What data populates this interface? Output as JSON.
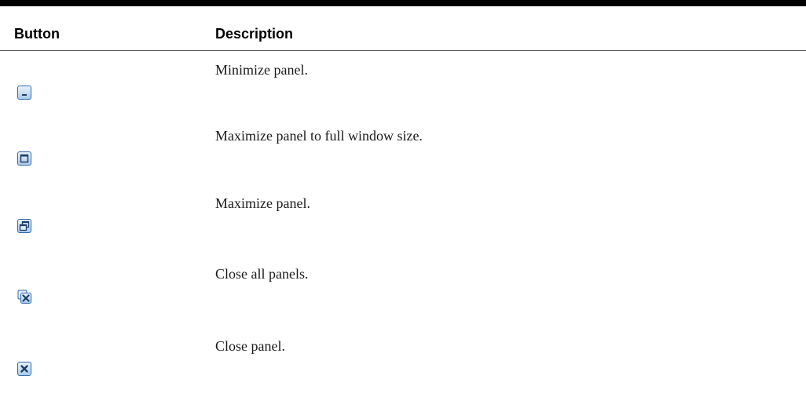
{
  "table": {
    "headers": {
      "button": "Button",
      "description": "Description"
    },
    "rows": [
      {
        "icon": "minimize-icon",
        "description": "Minimize panel."
      },
      {
        "icon": "maximize-icon",
        "description": "Maximize panel to full window size."
      },
      {
        "icon": "restore-icon",
        "description": "Maximize panel."
      },
      {
        "icon": "close-all-icon",
        "description": "Close all panels."
      },
      {
        "icon": "close-icon",
        "description": "Close panel."
      }
    ]
  },
  "colors": {
    "icon_fill": "#cfe3f7",
    "icon_border": "#2f6aa8",
    "icon_dark": "#1f3f66"
  }
}
